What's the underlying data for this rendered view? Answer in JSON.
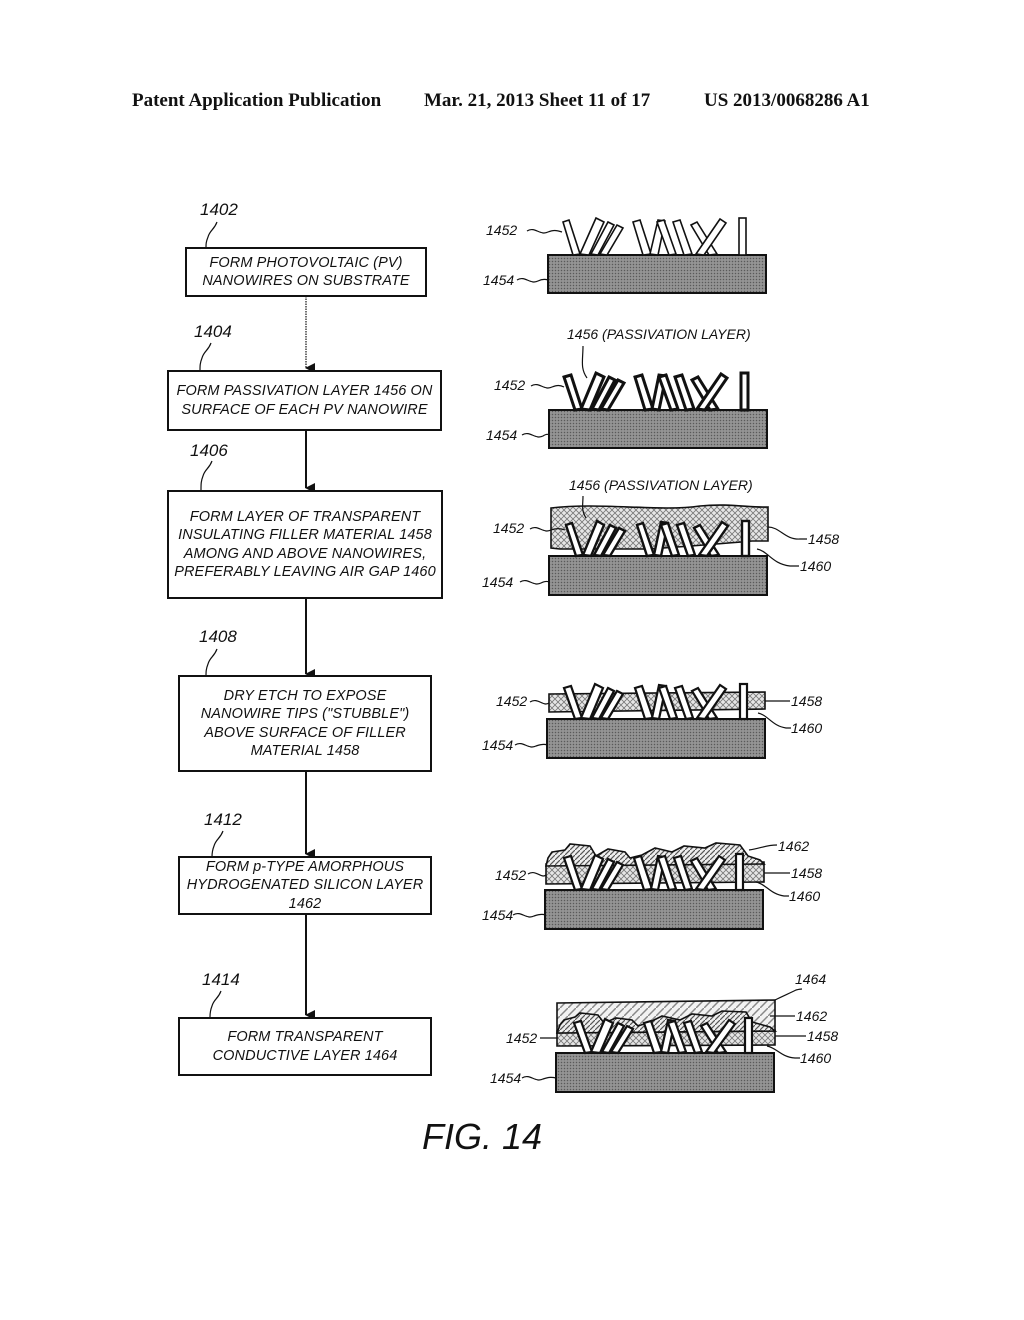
{
  "header": {
    "publication": "Patent Application Publication",
    "date_sheet": "Mar. 21, 2013  Sheet 11 of 17",
    "patent_number": "US 2013/0068286 A1"
  },
  "flowchart": {
    "steps": [
      {
        "ref": "1402",
        "text": "FORM PHOTOVOLTAIC (PV) NANOWIRES ON SUBSTRATE"
      },
      {
        "ref": "1404",
        "text": "FORM PASSIVATION LAYER 1456 ON SURFACE OF EACH PV NANOWIRE"
      },
      {
        "ref": "1406",
        "text": "FORM LAYER OF TRANSPARENT INSULATING FILLER MATERIAL 1458 AMONG AND ABOVE NANOWIRES, PREFERABLY LEAVING AIR GAP 1460"
      },
      {
        "ref": "1408",
        "text": "DRY ETCH TO EXPOSE NANOWIRE TIPS (\"STUBBLE\") ABOVE SURFACE OF FILLER MATERIAL 1458"
      },
      {
        "ref": "1412",
        "text": "FORM p-TYPE AMORPHOUS HYDROGENATED SILICON LAYER 1462"
      },
      {
        "ref": "1414",
        "text": "FORM TRANSPARENT CONDUCTIVE LAYER 1464"
      }
    ]
  },
  "diagrams": [
    {
      "labels": {
        "nanowires": "1452",
        "substrate": "1454"
      }
    },
    {
      "labels": {
        "passivation": "1456 (PASSIVATION LAYER)",
        "nanowires": "1452",
        "substrate": "1454"
      }
    },
    {
      "labels": {
        "passivation": "1456 (PASSIVATION LAYER)",
        "nanowires": "1452",
        "filler": "1458",
        "air_gap": "1460",
        "substrate": "1454"
      }
    },
    {
      "labels": {
        "nanowires": "1452",
        "filler": "1458",
        "air_gap": "1460",
        "substrate": "1454"
      }
    },
    {
      "labels": {
        "silicon": "1462",
        "nanowires": "1452",
        "filler": "1458",
        "air_gap": "1460",
        "substrate": "1454"
      }
    },
    {
      "labels": {
        "conductive": "1464",
        "silicon": "1462",
        "nanowires": "1452",
        "filler": "1458",
        "air_gap": "1460",
        "substrate": "1454"
      }
    }
  ],
  "figure_label": "FIG. 14"
}
